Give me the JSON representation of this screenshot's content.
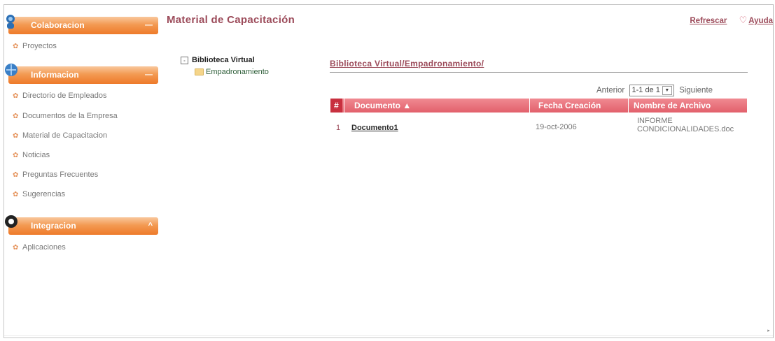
{
  "sidebar": {
    "sections": [
      {
        "title": "Colaboracion",
        "items": [
          "Proyectos"
        ]
      },
      {
        "title": "Informacion",
        "items": [
          "Directorio de Empleados",
          "Documentos de la Empresa",
          "Material de Capacitacion",
          "Noticias",
          "Preguntas Frecuentes",
          "Sugerencias"
        ]
      },
      {
        "title": "Integracion",
        "items": [
          "Aplicaciones"
        ]
      }
    ],
    "collapse_glyph": "—",
    "expand_glyph": "^"
  },
  "header": {
    "title": "Material de Capacitación",
    "refresh_label": "Refrescar",
    "help_label": "Ayuda"
  },
  "tree": {
    "root": "Biblioteca Virtual",
    "child": "Empadronamiento"
  },
  "path": "Biblioteca Virtual/Empadronamiento/",
  "pager": {
    "prev": "Anterior",
    "range": "1-1 de 1",
    "next": "Siguiente"
  },
  "table": {
    "columns": [
      "#",
      "Documento ▲",
      "Fecha Creación",
      "Nombre de Archivo"
    ],
    "rows": [
      {
        "num": "1",
        "documento": "Documento1",
        "fecha": "19-oct-2006",
        "nombre": "INFORME CONDICIONALIDADES.doc"
      }
    ]
  },
  "colors": {
    "accent": "#9c4b5a",
    "header_orange": "#f39a52",
    "table_header": "#e2606b"
  }
}
